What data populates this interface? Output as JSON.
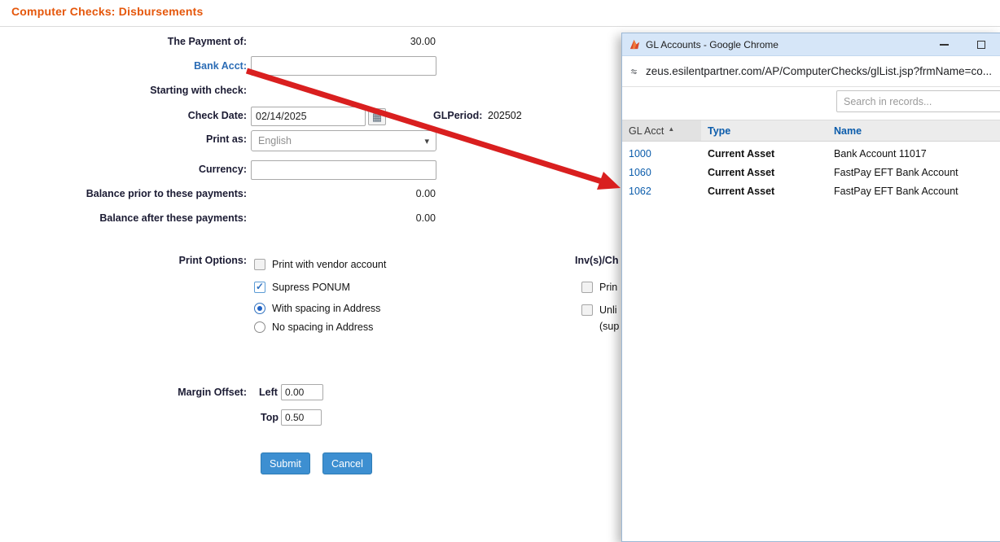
{
  "colors": {
    "title_orange": "#e5570b",
    "link_blue": "#2b6cb5",
    "button_blue": "#3d8fd1",
    "arrow_red": "#d91f1f",
    "titlebar_blue": "#d6e6f8",
    "table_link_blue": "#0b5cab"
  },
  "page": {
    "title": "Computer Checks: Disbursements"
  },
  "form": {
    "payment_label": "The Payment of:",
    "payment_value": "30.00",
    "bank_acct_label": "Bank Acct:",
    "starting_check_label": "Starting with check:",
    "check_date_label": "Check Date:",
    "check_date_value": "02/14/2025",
    "gl_period_label": "GLPeriod:",
    "gl_period_value": "202502",
    "print_as_label": "Print as:",
    "print_as_value": "English",
    "currency_label": "Currency:",
    "balance_prior_label": "Balance prior to these payments:",
    "balance_prior_value": "0.00",
    "balance_after_label": "Balance after these payments:",
    "balance_after_value": "0.00",
    "print_options_label": "Print Options:",
    "options": [
      {
        "type": "checkbox",
        "checked": false,
        "label": "Print with vendor account"
      },
      {
        "type": "checkbox",
        "checked": true,
        "label": "Supress PONUM"
      },
      {
        "type": "radio",
        "checked": true,
        "label": "With spacing in Address"
      },
      {
        "type": "radio",
        "checked": false,
        "label": "No spacing in Address"
      }
    ],
    "inv_section_label": "Inv(s)/Ch",
    "inv_options": [
      {
        "type": "checkbox",
        "checked": false,
        "label": "Prin"
      },
      {
        "type": "checkbox",
        "checked": false,
        "label": "Unli"
      }
    ],
    "inv_note": "(sup",
    "margin_offset_label": "Margin Offset:",
    "margin_left_label": "Left",
    "margin_left_value": "0.00",
    "margin_top_label": "Top",
    "margin_top_value": "0.50",
    "submit_label": "Submit",
    "cancel_label": "Cancel"
  },
  "popup": {
    "window_title": "GL Accounts - Google Chrome",
    "url": "zeus.esilentpartner.com/AP/ComputerChecks/glList.jsp?frmName=co...",
    "search_placeholder": "Search in records...",
    "table": {
      "col_acct": "GL Acct",
      "col_type": "Type",
      "col_name": "Name",
      "rows": [
        {
          "acct": "1000",
          "type": "Current Asset",
          "name": "Bank Account 11017"
        },
        {
          "acct": "1060",
          "type": "Current Asset",
          "name": "FastPay EFT Bank Account"
        },
        {
          "acct": "1062",
          "type": "Current Asset",
          "name": "FastPay EFT Bank Account"
        }
      ]
    }
  }
}
